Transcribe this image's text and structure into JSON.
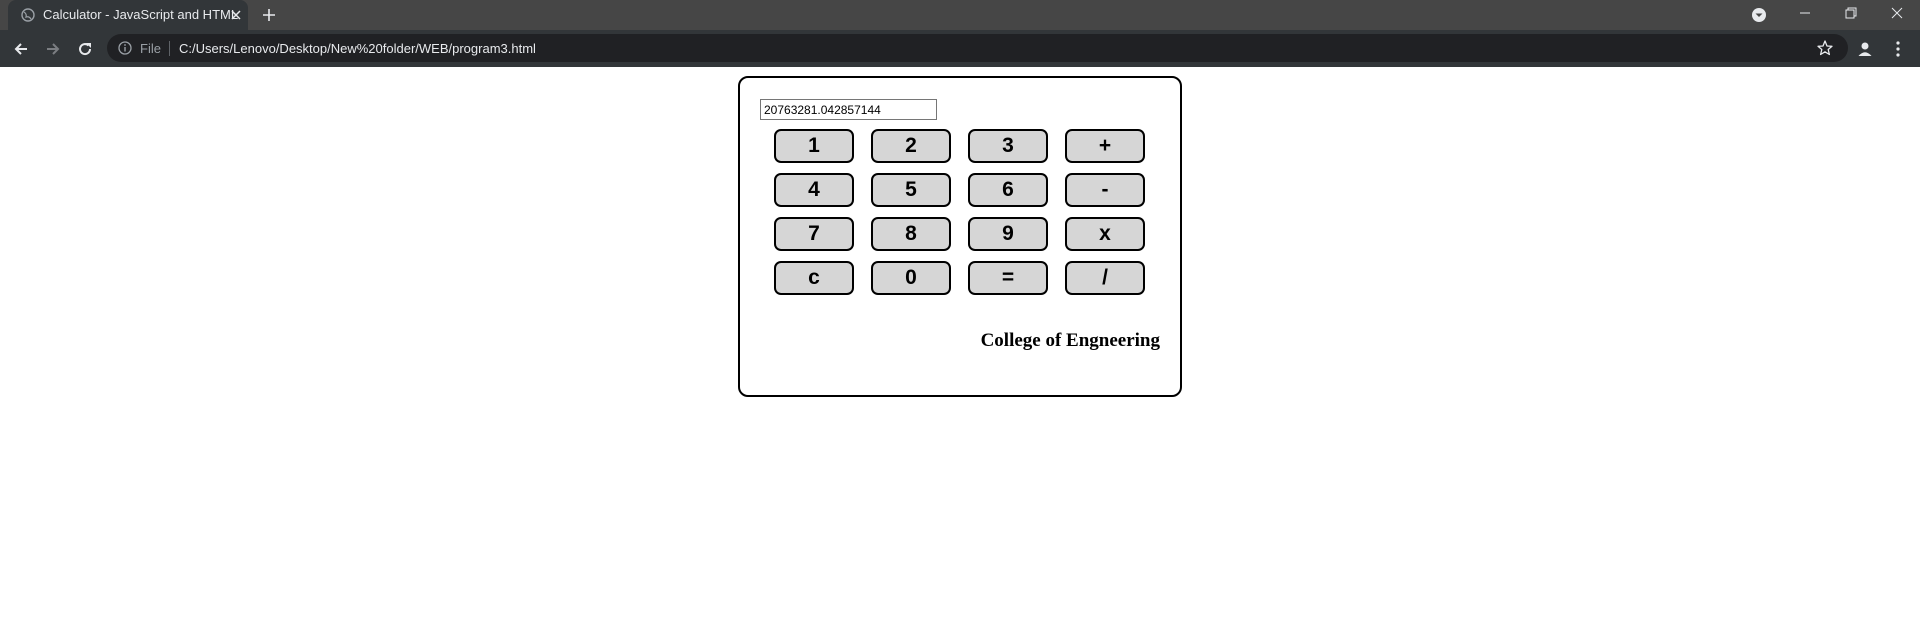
{
  "browser": {
    "tab": {
      "title": "Calculator - JavaScript and HTML"
    },
    "address_bar": {
      "scheme_label": "File",
      "url": "C:/Users/Lenovo/Desktop/New%20folder/WEB/program3.html"
    },
    "icons": {
      "favicon": "globe-icon",
      "tab_close": "close-icon",
      "new_tab": "plus-icon",
      "back": "arrow-left-icon",
      "forward": "arrow-right-icon",
      "reload": "reload-icon",
      "info": "info-icon",
      "bookmark": "star-icon",
      "account": "account-icon",
      "menu": "kebab-menu-icon"
    },
    "colors": {
      "titlebar": "#464646",
      "toolbar": "#323639",
      "omnibox": "#202124"
    }
  },
  "calculator": {
    "display_value": "20763281.042857144",
    "keys": {
      "k1": "1",
      "k2": "2",
      "k3": "3",
      "plus": "+",
      "k4": "4",
      "k5": "5",
      "k6": "6",
      "minus": "-",
      "k7": "7",
      "k8": "8",
      "k9": "9",
      "multiply": "x",
      "clear": "c",
      "k0": "0",
      "equals": "=",
      "divide": "/"
    },
    "footer_text": "College of Engneering",
    "colors": {
      "key_background": "#d6d6d6",
      "border": "#000000"
    }
  }
}
